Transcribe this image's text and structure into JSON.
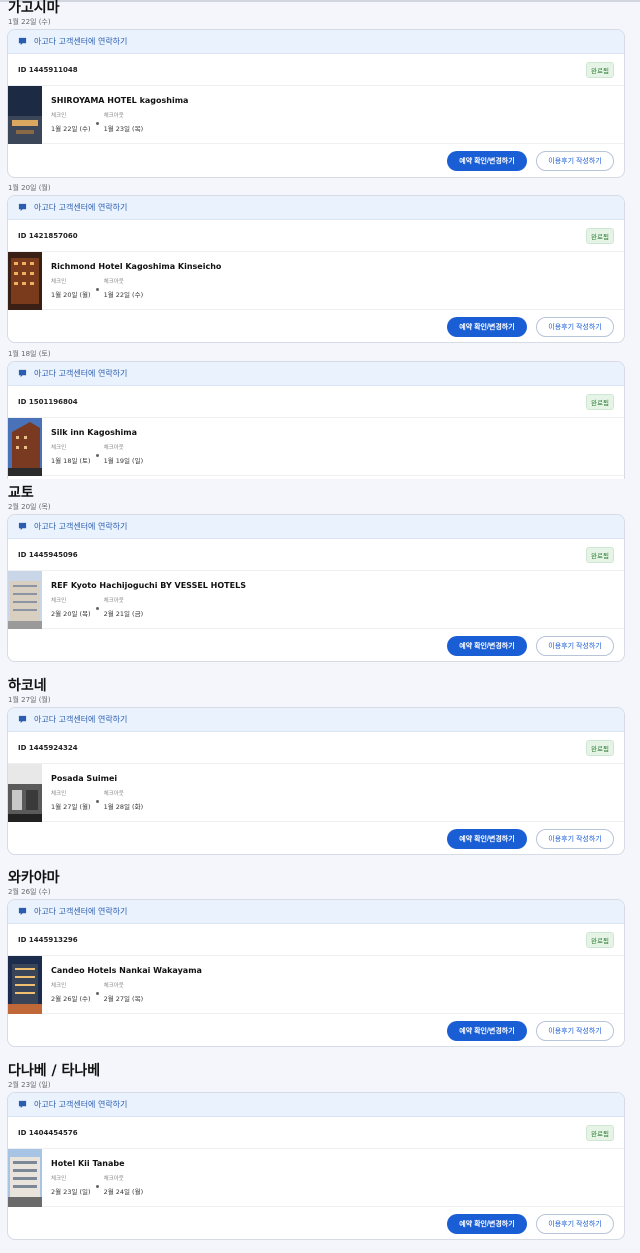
{
  "contact_label": "아고다 고객센터에 연락하기",
  "labels": {
    "checkin": "체크인",
    "checkout": "체크아웃",
    "status": "완료됨",
    "manage": "예약 확인/변경하기",
    "review": "이용후기 작성하기"
  },
  "groups": [
    {
      "title": "가고시마",
      "bookings": [
        {
          "date": "1월 22일 (수)",
          "id": "ID 1445911048",
          "hotel": "SHIROYAMA HOTEL kagoshima",
          "checkin": "1월 22일 (수)",
          "checkout": "1월 23일 (목)"
        },
        {
          "date": "1월 20일 (월)",
          "id": "ID 1421857060",
          "hotel": "Richmond Hotel Kagoshima Kinseicho",
          "checkin": "1월 20일 (월)",
          "checkout": "1월 22일 (수)"
        },
        {
          "date": "1월 18일 (토)",
          "id": "ID 1501196804",
          "hotel": "Silk inn Kagoshima",
          "checkin": "1월 18일 (토)",
          "checkout": "1월 19일 (일)"
        }
      ]
    },
    {
      "title": "교토",
      "bookings": [
        {
          "date": "2월 20일 (목)",
          "id": "ID 1445945096",
          "hotel": "REF Kyoto Hachijoguchi BY VESSEL HOTELS",
          "checkin": "2월 20일 (목)",
          "checkout": "2월 21일 (금)"
        }
      ]
    },
    {
      "title": "하코네",
      "bookings": [
        {
          "date": "1월 27일 (월)",
          "id": "ID 1445924324",
          "hotel": "Posada Suimei",
          "checkin": "1월 27일 (월)",
          "checkout": "1월 28일 (화)"
        }
      ]
    },
    {
      "title": "와카야마",
      "bookings": [
        {
          "date": "2월 26일 (수)",
          "id": "ID 1445913296",
          "hotel": "Candeo Hotels Nankai Wakayama",
          "checkin": "2월 26일 (수)",
          "checkout": "2월 27일 (목)"
        }
      ]
    },
    {
      "title": "다나베 / 타나베",
      "bookings": [
        {
          "date": "2월 23일 (일)",
          "id": "ID 1404454576",
          "hotel": "Hotel Kii Tanabe",
          "checkin": "2월 23일 (일)",
          "checkout": "2월 24일 (월)"
        }
      ]
    }
  ]
}
